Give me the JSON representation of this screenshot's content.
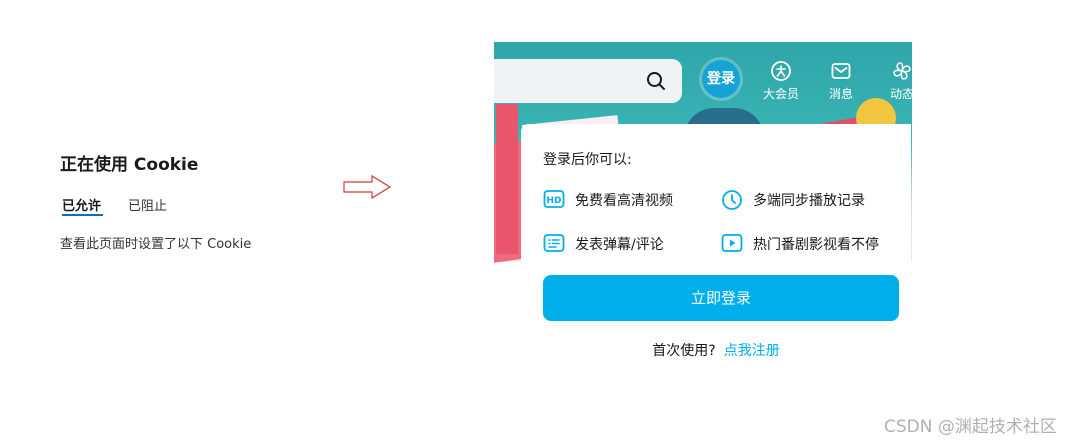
{
  "cookie_panel": {
    "title": "正在使用 Cookie",
    "tabs": [
      {
        "label": "已允许",
        "active": true
      },
      {
        "label": "已阻止",
        "active": false
      }
    ],
    "description": "查看此页面时设置了以下 Cookie"
  },
  "arrow": {
    "icon": "right-arrow-icon",
    "color": "#d23b3b"
  },
  "site": {
    "search": {
      "icon": "search-icon"
    },
    "header": {
      "login_label": "登录",
      "nav": [
        {
          "label": "大会员",
          "icon": "vip-icon"
        },
        {
          "label": "消息",
          "icon": "mail-icon"
        },
        {
          "label": "动态",
          "icon": "fan-icon"
        }
      ]
    },
    "login_popup": {
      "heading": "登录后你可以:",
      "features": [
        {
          "label": "免费看高清视频",
          "icon": "hd-icon"
        },
        {
          "label": "多端同步播放记录",
          "icon": "clock-icon"
        },
        {
          "label": "发表弹幕/评论",
          "icon": "comment-list-icon"
        },
        {
          "label": "热门番剧影视看不停",
          "icon": "play-icon"
        }
      ],
      "login_button": "立即登录",
      "register_prompt": "首次使用?",
      "register_link": "点我注册"
    },
    "colors": {
      "accent": "#00aeec",
      "login_circle": "#16a4d8"
    }
  },
  "watermark": "CSDN @渊起技术社区"
}
